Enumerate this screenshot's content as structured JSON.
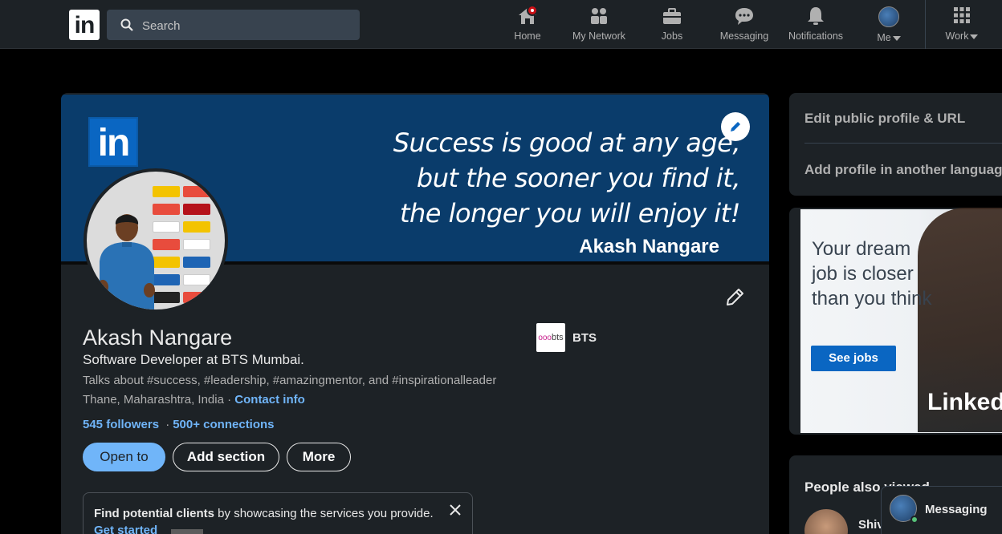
{
  "nav": {
    "logo": "in",
    "search_placeholder": "Search",
    "items": [
      {
        "label": "Home"
      },
      {
        "label": "My Network"
      },
      {
        "label": "Jobs"
      },
      {
        "label": "Messaging"
      },
      {
        "label": "Notifications"
      },
      {
        "label": "Me"
      },
      {
        "label": "Work"
      }
    ]
  },
  "banner": {
    "logo": "in",
    "quote_lines": [
      "Success is good at any age,",
      "but the sooner you find it,",
      "the longer you will enjoy it!"
    ],
    "name": "Akash Nangare"
  },
  "profile": {
    "name": "Akash Nangare",
    "headline": "Software Developer at BTS Mumbai.",
    "talks_about": "Talks about #success, #leadership, #amazingmentor, and #inspirationalleader",
    "location": "Thane, Maharashtra, India",
    "location_sep": " · ",
    "contact_info": "Contact info",
    "followers": "545 followers",
    "conn_sep": "·",
    "connections": "500+ connections",
    "company_logo": "bts",
    "company": "BTS",
    "buttons": {
      "open_to": "Open to",
      "add_section": "Add section",
      "more": "More"
    }
  },
  "client_box": {
    "bold": "Find potential clients",
    "rest": " by showcasing the services you provide.",
    "link": "Get started"
  },
  "side": {
    "edit_profile": "Edit public profile & URL",
    "add_language": "Add profile in another language"
  },
  "ad": {
    "headline": "Your dream job is closer than you think",
    "button": "See jobs",
    "brand": "Linked"
  },
  "people": {
    "title": "People also viewed",
    "first_name": "Shiv"
  },
  "messaging": {
    "label": "Messaging"
  },
  "colors": {
    "accent": "#70b5f9",
    "brand_blue": "#0a66c2",
    "surface": "#1d2226",
    "background": "#000000"
  }
}
